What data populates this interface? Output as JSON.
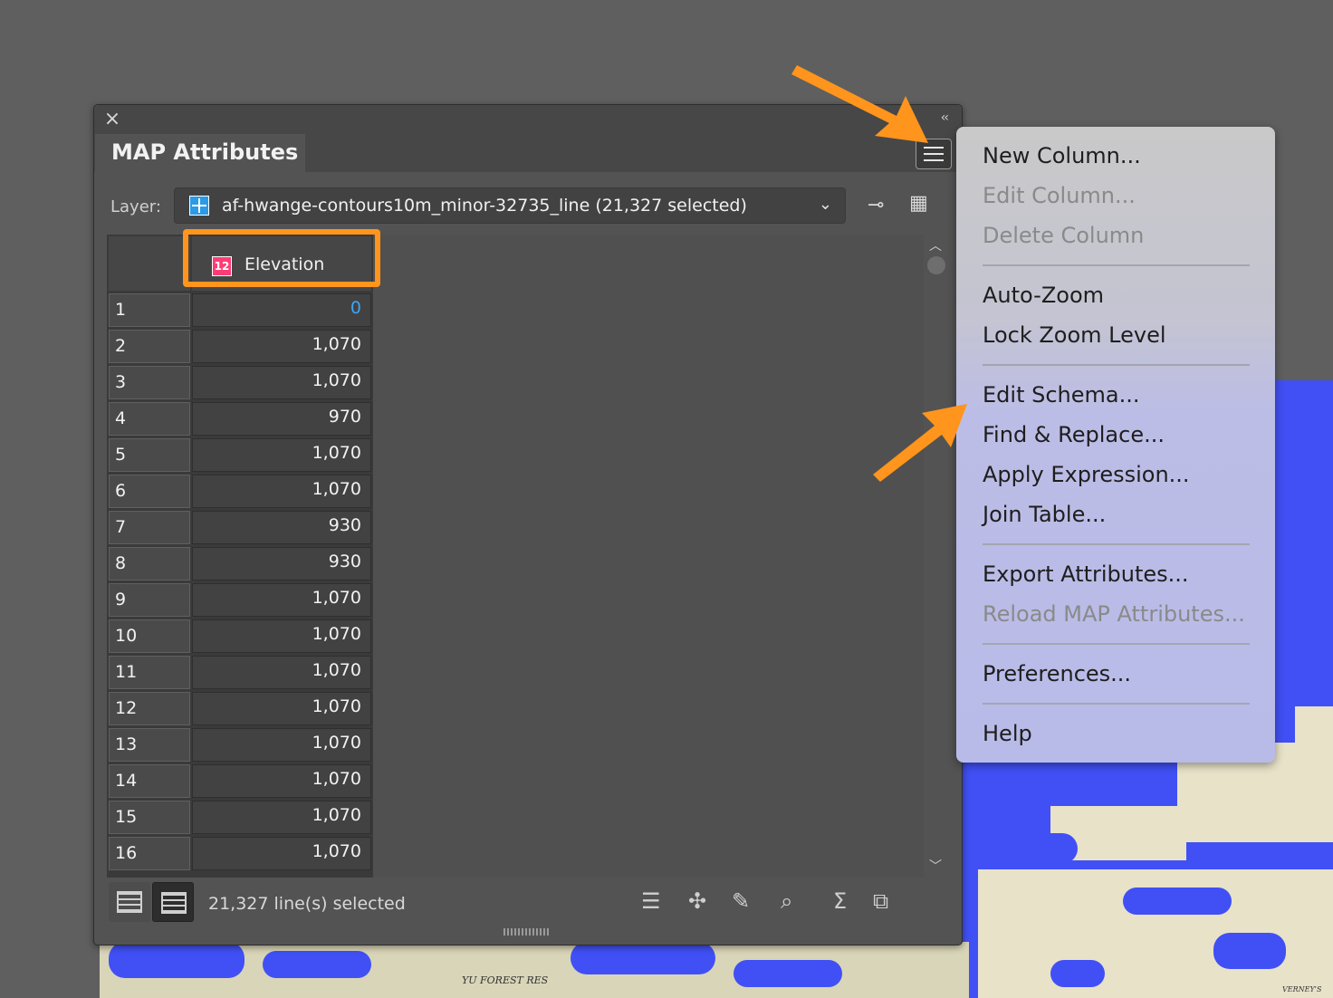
{
  "panel": {
    "title": "MAP Attributes",
    "collapse_label": "‹‹",
    "close_label": "×"
  },
  "layer": {
    "label": "Layer:",
    "value": "af-hwange-contours10m_minor-32735_line (21,327 selected)"
  },
  "table": {
    "column_header": "Elevation",
    "column_type_icon": "12",
    "rows": [
      {
        "n": "1",
        "v": "0"
      },
      {
        "n": "2",
        "v": "1,070"
      },
      {
        "n": "3",
        "v": "1,070"
      },
      {
        "n": "4",
        "v": "970"
      },
      {
        "n": "5",
        "v": "1,070"
      },
      {
        "n": "6",
        "v": "1,070"
      },
      {
        "n": "7",
        "v": "930"
      },
      {
        "n": "8",
        "v": "930"
      },
      {
        "n": "9",
        "v": "1,070"
      },
      {
        "n": "10",
        "v": "1,070"
      },
      {
        "n": "11",
        "v": "1,070"
      },
      {
        "n": "12",
        "v": "1,070"
      },
      {
        "n": "13",
        "v": "1,070"
      },
      {
        "n": "14",
        "v": "1,070"
      },
      {
        "n": "15",
        "v": "1,070"
      },
      {
        "n": "16",
        "v": "1,070"
      }
    ]
  },
  "footer": {
    "status": "21,327 line(s) selected"
  },
  "menu": {
    "new_column": "New Column...",
    "edit_column": "Edit Column...",
    "delete_column": "Delete Column",
    "auto_zoom": "Auto-Zoom",
    "lock_zoom": "Lock Zoom Level",
    "edit_schema": "Edit Schema...",
    "find_replace": "Find & Replace...",
    "apply_expression": "Apply Expression...",
    "join_table": "Join Table...",
    "export_attributes": "Export Attributes...",
    "reload_attributes": "Reload MAP Attributes...",
    "preferences": "Preferences...",
    "help": "Help"
  },
  "map": {
    "label_forest": "YU FOREST RES",
    "label_verney": "VERNEY'S"
  },
  "colors": {
    "accent_orange": "#ff951c",
    "map_blue": "#4150f5",
    "value_blue": "#3ea5f2"
  }
}
